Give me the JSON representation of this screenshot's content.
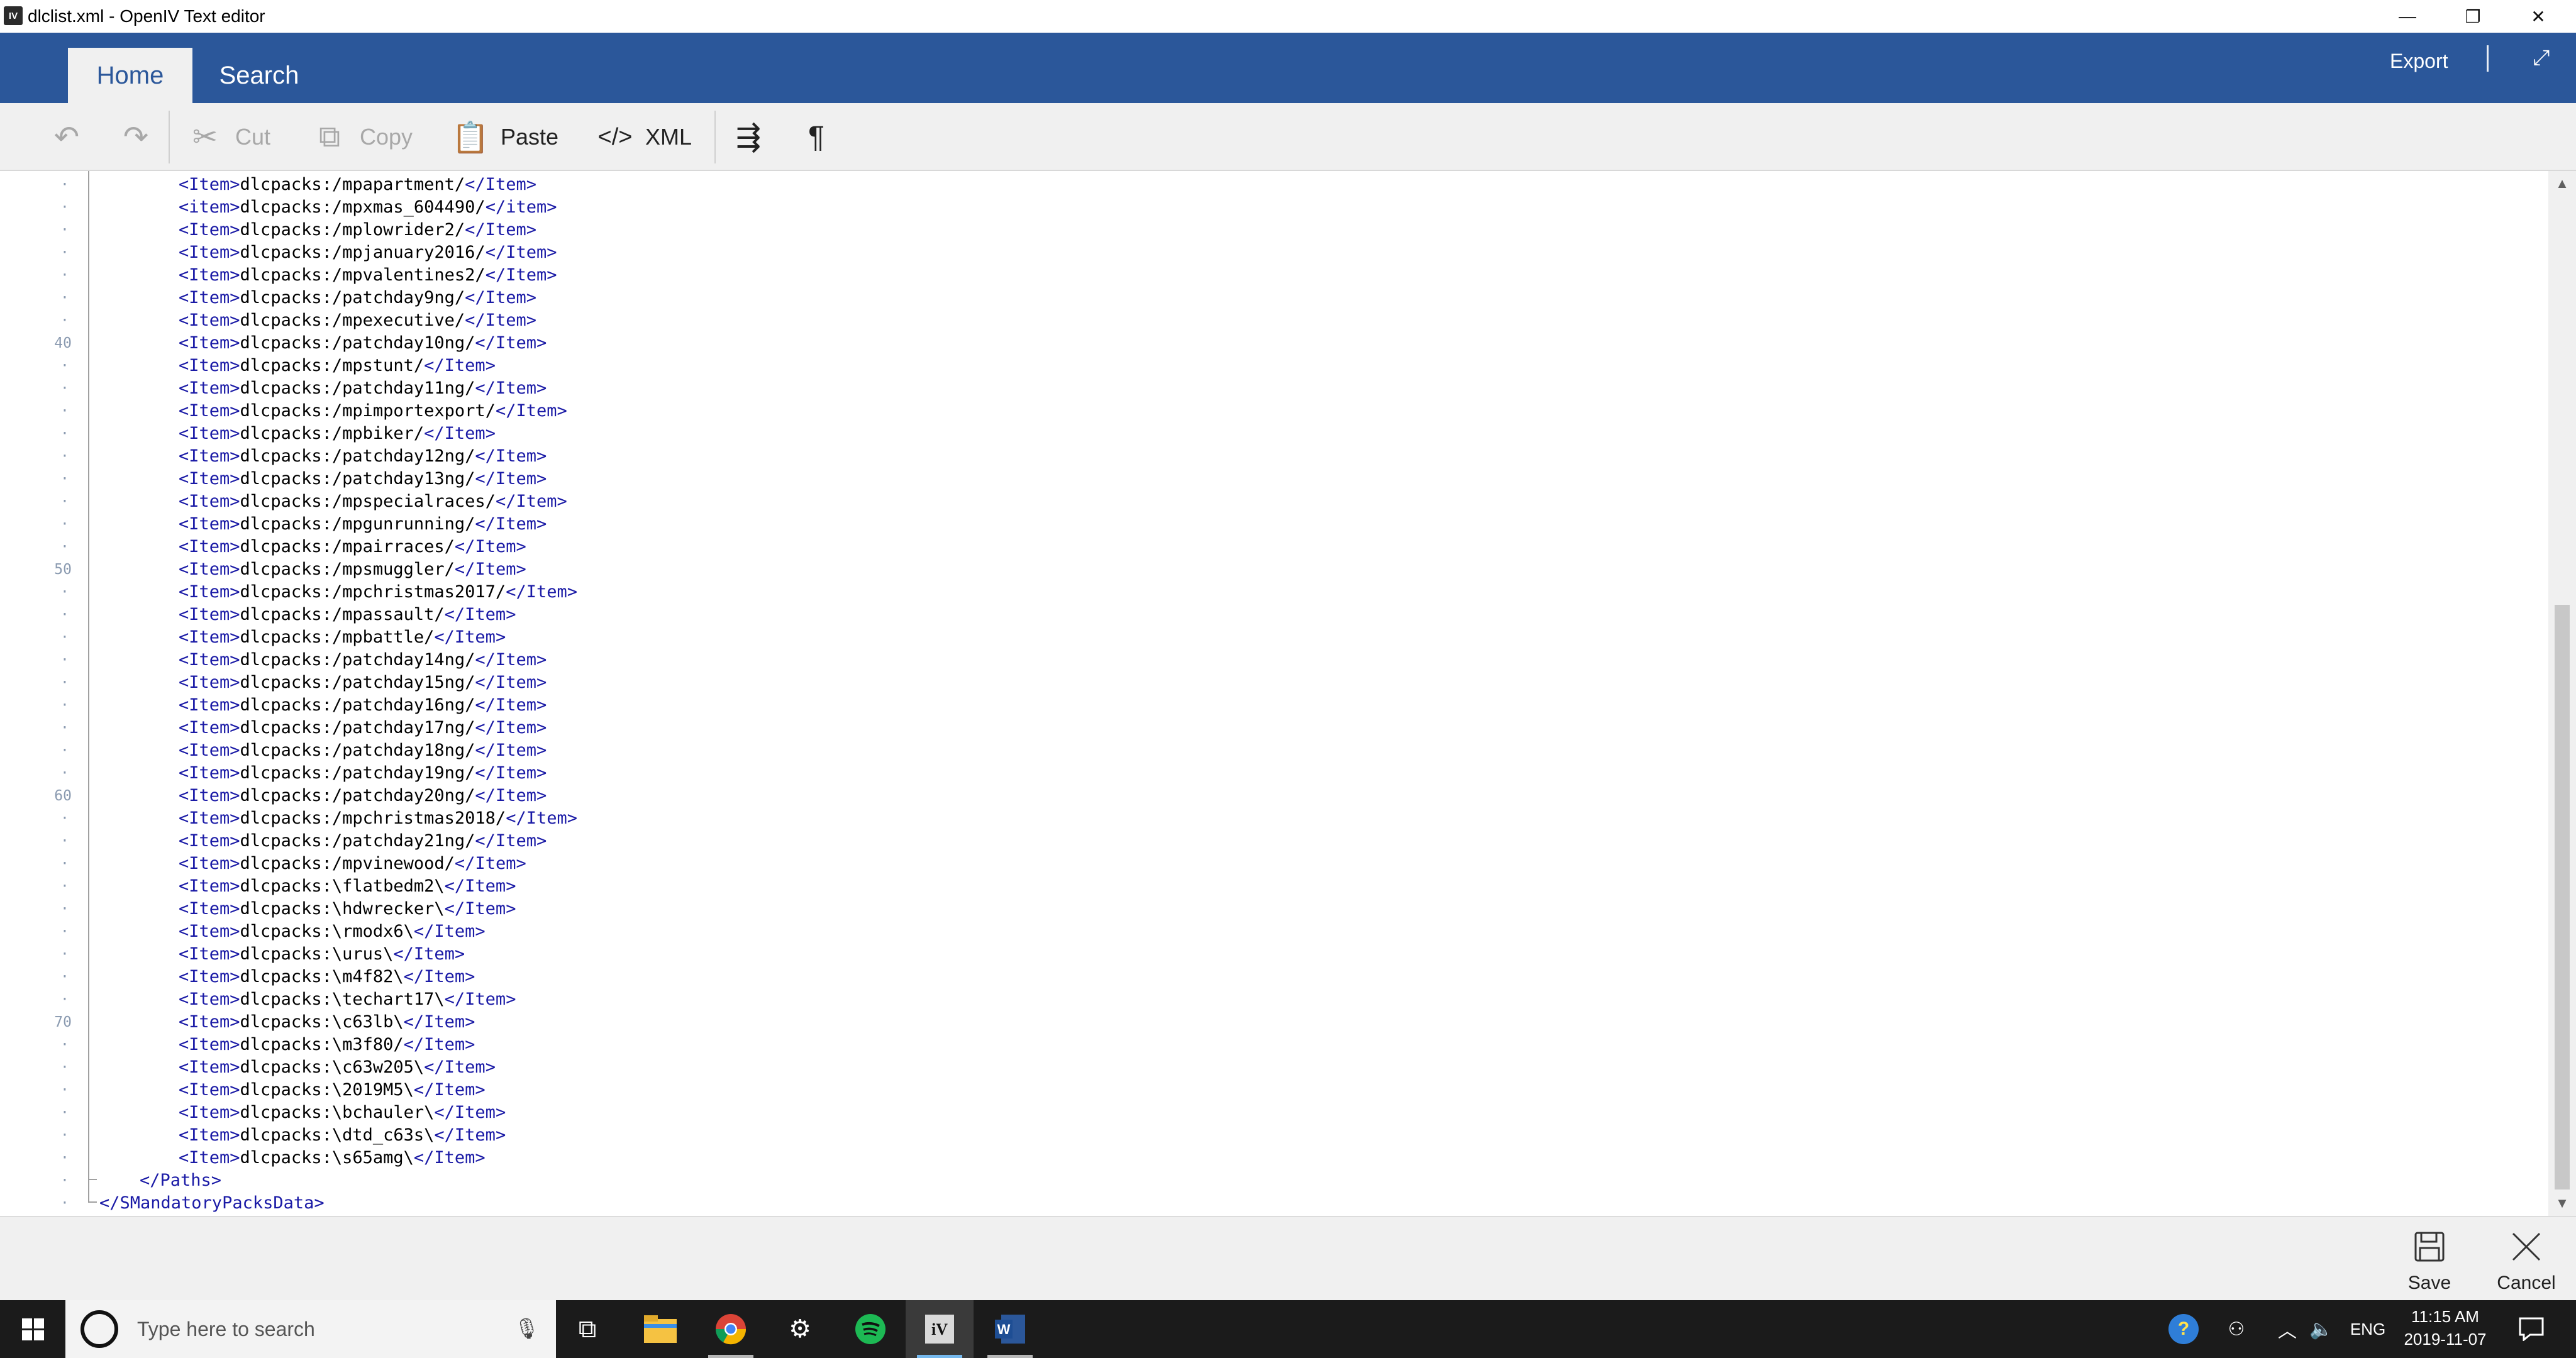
{
  "window": {
    "app_logo_text": "IV",
    "title": "dlclist.xml - OpenIV Text editor",
    "minimize_glyph": "—",
    "restore_glyph": "❐",
    "close_glyph": "✕"
  },
  "ribbon": {
    "tabs": [
      {
        "label": "Home",
        "active": true
      },
      {
        "label": "Search",
        "active": false
      }
    ],
    "export_label": "Export",
    "expand_glyph": "⤢"
  },
  "toolbar": {
    "undo_icon": "undo-icon",
    "redo_icon": "redo-icon",
    "cut_label": "Cut",
    "copy_label": "Copy",
    "paste_label": "Paste",
    "xml_label": "XML",
    "wordwrap_icon": "word-wrap-icon",
    "pilcrow_icon": "pilcrow-icon"
  },
  "editor": {
    "gutter_labels": [
      {
        "row": 7,
        "text": "40"
      },
      {
        "row": 17,
        "text": "50"
      },
      {
        "row": 27,
        "text": "60"
      },
      {
        "row": 37,
        "text": "70"
      }
    ],
    "lines": [
      {
        "indent": 4,
        "tag_open": "<Item>",
        "text": "dlcpacks:/mpapartment/",
        "tag_close": "</Item>"
      },
      {
        "indent": 4,
        "tag_open": "<item>",
        "text": "dlcpacks:/mpxmas_604490/",
        "tag_close": "</item>"
      },
      {
        "indent": 4,
        "tag_open": "<Item>",
        "text": "dlcpacks:/mplowrider2/",
        "tag_close": "</Item>"
      },
      {
        "indent": 4,
        "tag_open": "<Item>",
        "text": "dlcpacks:/mpjanuary2016/",
        "tag_close": "</Item>"
      },
      {
        "indent": 4,
        "tag_open": "<Item>",
        "text": "dlcpacks:/mpvalentines2/",
        "tag_close": "</Item>"
      },
      {
        "indent": 4,
        "tag_open": "<Item>",
        "text": "dlcpacks:/patchday9ng/",
        "tag_close": "</Item>"
      },
      {
        "indent": 4,
        "tag_open": "<Item>",
        "text": "dlcpacks:/mpexecutive/",
        "tag_close": "</Item>"
      },
      {
        "indent": 4,
        "tag_open": "<Item>",
        "text": "dlcpacks:/patchday10ng/",
        "tag_close": "</Item>"
      },
      {
        "indent": 4,
        "tag_open": "<Item>",
        "text": "dlcpacks:/mpstunt/",
        "tag_close": "</Item>"
      },
      {
        "indent": 4,
        "tag_open": "<Item>",
        "text": "dlcpacks:/patchday11ng/",
        "tag_close": "</Item>"
      },
      {
        "indent": 4,
        "tag_open": "<Item>",
        "text": "dlcpacks:/mpimportexport/",
        "tag_close": "</Item>"
      },
      {
        "indent": 4,
        "tag_open": "<Item>",
        "text": "dlcpacks:/mpbiker/",
        "tag_close": "</Item>"
      },
      {
        "indent": 4,
        "tag_open": "<Item>",
        "text": "dlcpacks:/patchday12ng/",
        "tag_close": "</Item>"
      },
      {
        "indent": 4,
        "tag_open": "<Item>",
        "text": "dlcpacks:/patchday13ng/",
        "tag_close": "</Item>"
      },
      {
        "indent": 4,
        "tag_open": "<Item>",
        "text": "dlcpacks:/mpspecialraces/",
        "tag_close": "</Item>"
      },
      {
        "indent": 4,
        "tag_open": "<Item>",
        "text": "dlcpacks:/mpgunrunning/",
        "tag_close": "</Item>"
      },
      {
        "indent": 4,
        "tag_open": "<Item>",
        "text": "dlcpacks:/mpairraces/",
        "tag_close": "</Item>"
      },
      {
        "indent": 4,
        "tag_open": "<Item>",
        "text": "dlcpacks:/mpsmuggler/",
        "tag_close": "</Item>"
      },
      {
        "indent": 4,
        "tag_open": "<Item>",
        "text": "dlcpacks:/mpchristmas2017/",
        "tag_close": "</Item>"
      },
      {
        "indent": 4,
        "tag_open": "<Item>",
        "text": "dlcpacks:/mpassault/",
        "tag_close": "</Item>"
      },
      {
        "indent": 4,
        "tag_open": "<Item>",
        "text": "dlcpacks:/mpbattle/",
        "tag_close": "</Item>"
      },
      {
        "indent": 4,
        "tag_open": "<Item>",
        "text": "dlcpacks:/patchday14ng/",
        "tag_close": "</Item>"
      },
      {
        "indent": 4,
        "tag_open": "<Item>",
        "text": "dlcpacks:/patchday15ng/",
        "tag_close": "</Item>"
      },
      {
        "indent": 4,
        "tag_open": "<Item>",
        "text": "dlcpacks:/patchday16ng/",
        "tag_close": "</Item>"
      },
      {
        "indent": 4,
        "tag_open": "<Item>",
        "text": "dlcpacks:/patchday17ng/",
        "tag_close": "</Item>"
      },
      {
        "indent": 4,
        "tag_open": "<Item>",
        "text": "dlcpacks:/patchday18ng/",
        "tag_close": "</Item>"
      },
      {
        "indent": 4,
        "tag_open": "<Item>",
        "text": "dlcpacks:/patchday19ng/",
        "tag_close": "</Item>"
      },
      {
        "indent": 4,
        "tag_open": "<Item>",
        "text": "dlcpacks:/patchday20ng/",
        "tag_close": "</Item>"
      },
      {
        "indent": 4,
        "tag_open": "<Item>",
        "text": "dlcpacks:/mpchristmas2018/",
        "tag_close": "</Item>"
      },
      {
        "indent": 4,
        "tag_open": "<Item>",
        "text": "dlcpacks:/patchday21ng/",
        "tag_close": "</Item>"
      },
      {
        "indent": 4,
        "tag_open": "<Item>",
        "text": "dlcpacks:/mpvinewood/",
        "tag_close": "</Item>"
      },
      {
        "indent": 4,
        "tag_open": "<Item>",
        "text": "dlcpacks:\\flatbedm2\\",
        "tag_close": "</Item>"
      },
      {
        "indent": 4,
        "tag_open": "<Item>",
        "text": "dlcpacks:\\hdwrecker\\",
        "tag_close": "</Item>"
      },
      {
        "indent": 4,
        "tag_open": "<Item>",
        "text": "dlcpacks:\\rmodx6\\",
        "tag_close": "</Item>"
      },
      {
        "indent": 4,
        "tag_open": "<Item>",
        "text": "dlcpacks:\\urus\\",
        "tag_close": "</Item>"
      },
      {
        "indent": 4,
        "tag_open": "<Item>",
        "text": "dlcpacks:\\m4f82\\",
        "tag_close": "</Item>"
      },
      {
        "indent": 4,
        "tag_open": "<Item>",
        "text": "dlcpacks:\\techart17\\",
        "tag_close": "</Item>"
      },
      {
        "indent": 4,
        "tag_open": "<Item>",
        "text": "dlcpacks:\\c63lb\\",
        "tag_close": "</Item>"
      },
      {
        "indent": 4,
        "tag_open": "<Item>",
        "text": "dlcpacks:\\m3f80/",
        "tag_close": "</Item>"
      },
      {
        "indent": 4,
        "tag_open": "<Item>",
        "text": "dlcpacks:\\c63w205\\",
        "tag_close": "</Item>"
      },
      {
        "indent": 4,
        "tag_open": "<Item>",
        "text": "dlcpacks:\\2019M5\\",
        "tag_close": "</Item>"
      },
      {
        "indent": 4,
        "tag_open": "<Item>",
        "text": "dlcpacks:\\bchauler\\",
        "tag_close": "</Item>"
      },
      {
        "indent": 4,
        "tag_open": "<Item>",
        "text": "dlcpacks:\\dtd_c63s\\",
        "tag_close": "</Item>"
      },
      {
        "indent": 4,
        "tag_open": "<Item>",
        "text": "dlcpacks:\\s65amg\\",
        "tag_close": "</Item>"
      },
      {
        "indent": 2,
        "tag_open": "",
        "text": "",
        "tag_close": "</Paths>"
      },
      {
        "indent": 0,
        "tag_open": "",
        "text": "",
        "tag_close": "</SMandatoryPacksData>"
      }
    ]
  },
  "actions": {
    "save_label": "Save",
    "cancel_label": "Cancel"
  },
  "taskbar": {
    "search_placeholder": "Type here to search",
    "language": "ENG",
    "time": "11:15 AM",
    "date": "2019-11-07"
  },
  "colors": {
    "ribbon": "#2b579a",
    "tag": "#1a1aa6",
    "taskbar": "#1b1b1b"
  }
}
